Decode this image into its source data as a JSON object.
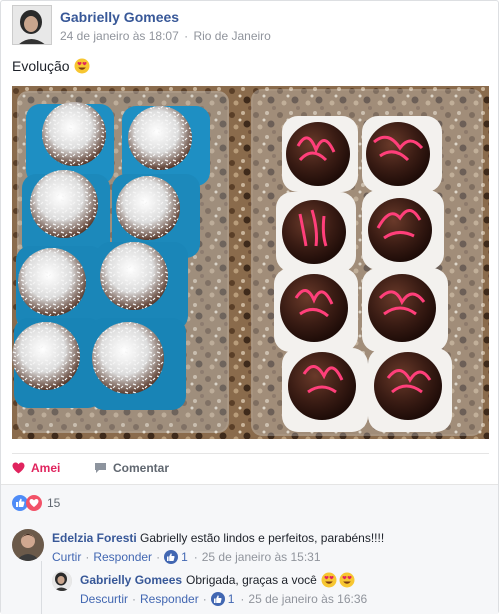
{
  "post": {
    "author": "Gabrielly Gomees",
    "date": "24 de janeiro às 18:07",
    "separator": "·",
    "location": "Rio de Janeiro",
    "caption": "Evolução"
  },
  "actions": {
    "like_label": "Amei",
    "comment_label": "Comentar"
  },
  "reactions": {
    "count": "15",
    "icons": [
      "like-icon",
      "love-icon"
    ]
  },
  "comments": [
    {
      "author": "Edelzia Foresti",
      "text": "Gabrielly estão lindos e perfeitos, parabéns!!!!",
      "like_label": "Curtir",
      "reply_label": "Responder",
      "likes": "1",
      "date": "25 de janeiro às 15:31"
    },
    {
      "author": "Gabrielly Gomees",
      "text": "Obrigada, graças a você",
      "like_label": "Descurtir",
      "reply_label": "Responder",
      "likes": "1",
      "date": "25 de janeiro às 16:36"
    }
  ],
  "colors": {
    "link_blue": "#385898",
    "love_red": "#e0245e",
    "muted": "#90949c"
  }
}
